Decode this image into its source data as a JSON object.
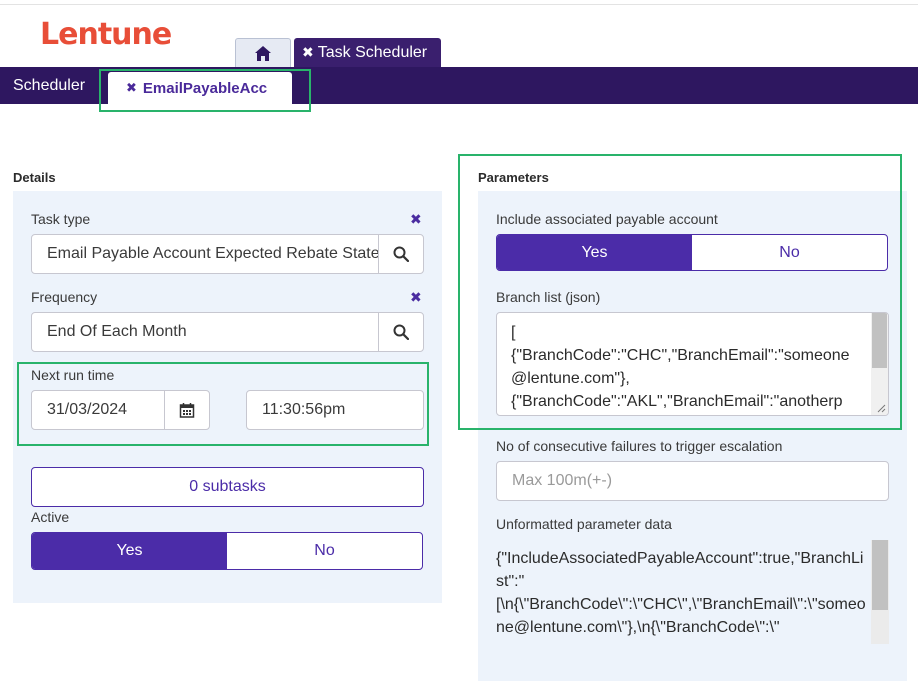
{
  "logo": {
    "text": "Lentune",
    "color": "#e84e38"
  },
  "tabs": {
    "home_icon": "home-icon",
    "active_label": "Task Scheduler",
    "close_icon": "close-icon"
  },
  "nav": {
    "scheduler_label": "Scheduler",
    "subtab_label": "EmailPayableAcc"
  },
  "details": {
    "title": "Details",
    "task_type_label": "Task type",
    "task_type_value": "Email Payable Account Expected Rebate Statement",
    "frequency_label": "Frequency",
    "frequency_value": "End Of Each Month",
    "next_run_label": "Next run time",
    "date_value": "31/03/2024",
    "time_value": "11:30:56pm",
    "subtasks_label": "0 subtasks",
    "active_label": "Active",
    "active_yes": "Yes",
    "active_no": "No",
    "active_selected": "Yes"
  },
  "parameters": {
    "title": "Parameters",
    "include_label": "Include associated payable account",
    "include_yes": "Yes",
    "include_no": "No",
    "include_selected": "Yes",
    "branch_label": "Branch list (json)",
    "branch_value": "[\n{\"BranchCode\":\"CHC\",\"BranchEmail\":\"someone@lentune.com\"},\n{\"BranchCode\":\"AKL\",\"BranchEmail\":\"anotherp",
    "failures_label": "No of consecutive failures to trigger escalation",
    "failures_placeholder": "Max 100m(+-)",
    "raw_label": "Unformatted parameter data",
    "raw_value": "{\"IncludeAssociatedPayableAccount\":true,\"BranchList\":\"\n[\\n{\\\"BranchCode\\\":\\\"CHC\\\",\\\"BranchEmail\\\":\\\"someone@lentune.com\\\"},\\n{\\\"BranchCode\\\":\\\""
  },
  "colors": {
    "nav": "#2e1760",
    "accent": "#4b2ca8",
    "highlight": "#29b36b",
    "panel": "#edf3fb"
  }
}
